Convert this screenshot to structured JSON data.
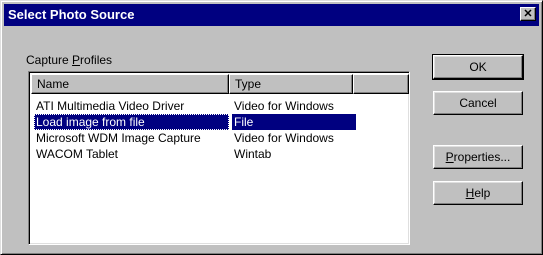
{
  "window": {
    "title": "Select Photo Source",
    "close_glyph": "✕",
    "close_icon": "close-icon"
  },
  "group": {
    "label_pre": "Capture ",
    "label_access": "P",
    "label_post": "rofiles"
  },
  "list": {
    "columns": [
      "Name",
      "Type"
    ],
    "rows": [
      {
        "name": "ATI Multimedia Video Driver",
        "type": "Video for Windows",
        "selected": false
      },
      {
        "name": "Load image from file",
        "type": "File",
        "selected": true
      },
      {
        "name": "Microsoft WDM Image Capture",
        "type": "Video for Windows",
        "selected": false
      },
      {
        "name": "WACOM Tablet",
        "type": "Wintab",
        "selected": false
      }
    ]
  },
  "buttons": {
    "ok": "OK",
    "cancel": "Cancel",
    "properties_access": "P",
    "properties_rest": "roperties...",
    "help_access": "H",
    "help_rest": "elp"
  },
  "colors": {
    "titlebar": "#000080",
    "face": "#c0c0c0",
    "selection": "#000080"
  }
}
